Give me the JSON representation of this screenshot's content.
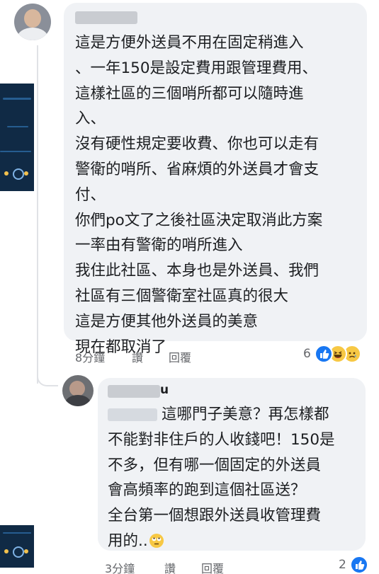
{
  "comment": {
    "lines": [
      "這是方便外送員不用在固定稍進入",
      "、一年150是設定費用跟管理費用、",
      "這樣社區的三個哨所都可以隨時進",
      "入、",
      "沒有硬性規定要收費、你也可以走有",
      "警衛的哨所、省麻煩的外送員才會支",
      "付、",
      "你們po文了之後社區決定取消此方案",
      "一率由有警衛的哨所進入",
      "我住此社區、本身也是外送員、我們",
      "社區有三個警衛室社區真的很大",
      "這是方便其他外送員的美意",
      "現在都取消了"
    ],
    "time": "8分鐘",
    "like_label": "讚",
    "reply_label": "回覆",
    "reaction_count": "6",
    "reactions": [
      "like-icon",
      "haha-icon",
      "sad-icon"
    ]
  },
  "reply": {
    "name_suffix": "u",
    "lines": [
      "這哪門子美意？再怎樣都",
      "不能對非住戶的人收錢吧！150是",
      "不多，但有哪一個固定的外送員",
      "會高頻率的跑到這個社區送？",
      "全台第一個想跟外送員收管理費",
      "用的.."
    ],
    "trailing_emoji": "eye-roll-emoji-icon",
    "time": "3分鐘",
    "like_label": "讚",
    "reply_label": "回覆",
    "reaction_count": "2",
    "reactions": [
      "like-icon"
    ]
  },
  "colors": {
    "bubble": "#f0f2f5",
    "text": "#1c1e21",
    "meta": "#65676b",
    "like": "#1877f2"
  }
}
